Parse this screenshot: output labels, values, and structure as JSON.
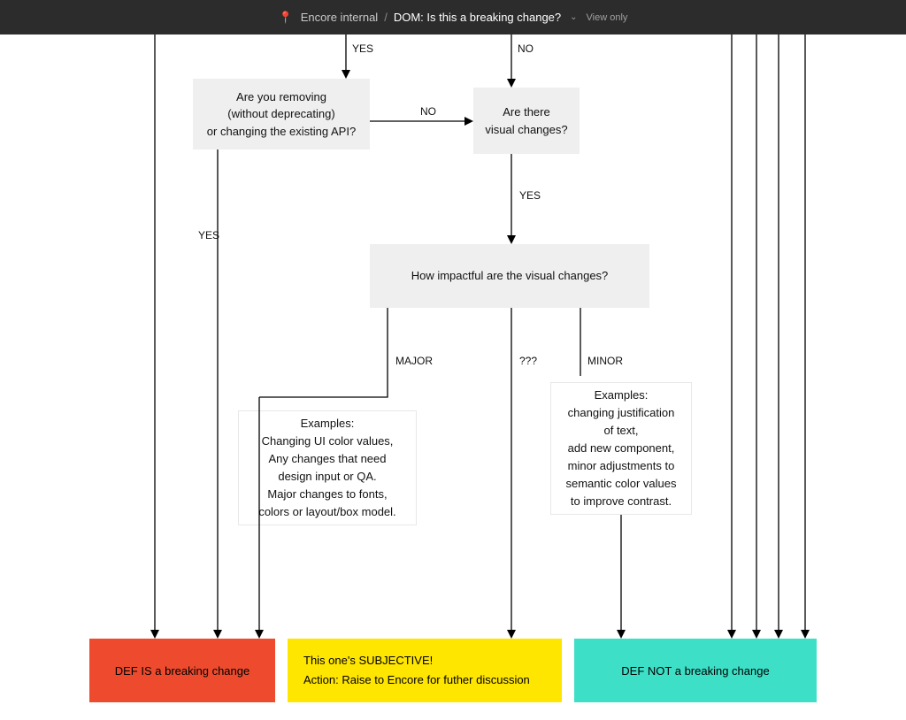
{
  "header": {
    "emoji": "📍",
    "crumb": "Encore internal",
    "separator": "/",
    "title": "DOM: Is this a breaking change?",
    "viewonly": "View only"
  },
  "labels": {
    "yes_top": "YES",
    "no_top": "NO",
    "yes_left": "YES",
    "no_mid": "NO",
    "yes_visual": "YES",
    "major": "MAJOR",
    "qqq": "???",
    "minor": "MINOR"
  },
  "nodes": {
    "removing": {
      "l1": "Are you removing",
      "l2": "(without deprecating)",
      "l3": "or changing the existing API?"
    },
    "visual": {
      "l1": "Are there",
      "l2": "visual changes?"
    },
    "impact": {
      "l1": "How impactful are the visual changes?"
    },
    "majorEx": {
      "l1": "Examples:",
      "l2": "Changing UI color values,",
      "l3": "Any changes that need",
      "l4": "design input or QA.",
      "l5": "Major changes to fonts,",
      "l6": "colors or layout/box model."
    },
    "minorEx": {
      "l1": "Examples:",
      "l2": "changing justification",
      "l3": "of text,",
      "l4": "add new component,",
      "l5": "minor adjustments to",
      "l6": "semantic color values",
      "l7": "to improve contrast."
    }
  },
  "results": {
    "red": "DEF IS a breaking change",
    "yellow_l1": "This one's SUBJECTIVE!",
    "yellow_l2": "Action: Raise to Encore for futher discussion",
    "teal": "DEF NOT a breaking change"
  }
}
